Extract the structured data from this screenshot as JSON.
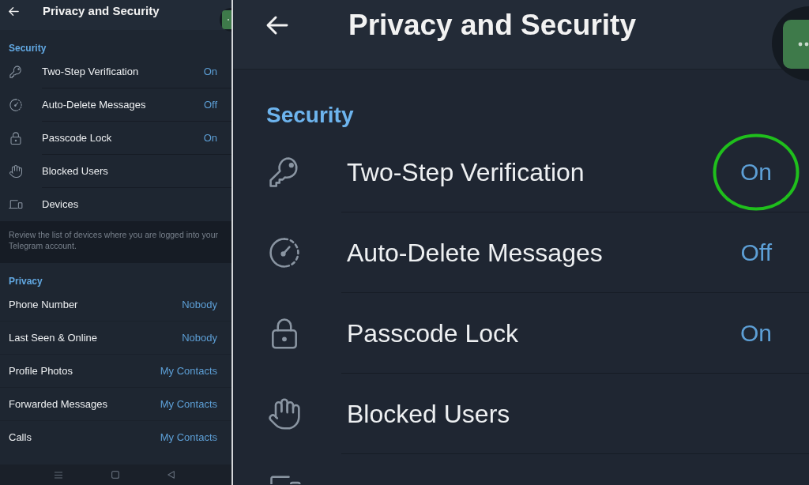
{
  "left_panel": {
    "header": {
      "title": "Privacy and Security"
    },
    "security": {
      "title": "Security",
      "items": [
        {
          "label": "Two-Step Verification",
          "value": "On"
        },
        {
          "label": "Auto-Delete Messages",
          "value": "Off"
        },
        {
          "label": "Passcode Lock",
          "value": "On"
        },
        {
          "label": "Blocked Users"
        },
        {
          "label": "Devices"
        }
      ]
    },
    "devices_note": "Review the list of devices where you are logged into your Telegram account.",
    "privacy": {
      "title": "Privacy",
      "items": [
        {
          "label": "Phone Number",
          "value": "Nobody"
        },
        {
          "label": "Last Seen & Online",
          "value": "Nobody"
        },
        {
          "label": "Profile Photos",
          "value": "My Contacts"
        },
        {
          "label": "Forwarded Messages",
          "value": "My Contacts"
        },
        {
          "label": "Calls",
          "value": "My Contacts"
        }
      ]
    }
  },
  "right_panel": {
    "header": {
      "title": "Privacy and Security"
    },
    "security": {
      "title": "Security",
      "items": [
        {
          "label": "Two-Step Verification",
          "value": "On",
          "highlighted": true
        },
        {
          "label": "Auto-Delete Messages",
          "value": "Off",
          "highlighted": false
        },
        {
          "label": "Passcode Lock",
          "value": "On",
          "highlighted": false
        },
        {
          "label": "Blocked Users",
          "highlighted": false
        }
      ]
    }
  }
}
